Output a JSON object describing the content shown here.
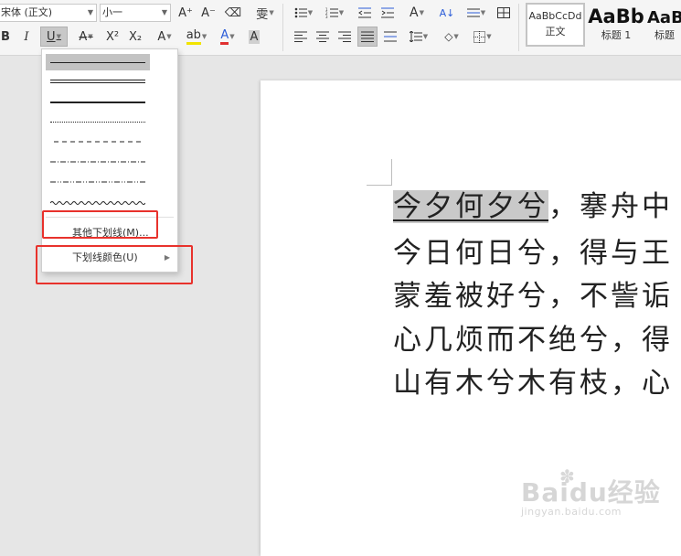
{
  "ribbon": {
    "font_name": "宋体 (正文)",
    "font_size": "小一",
    "btn_grow": "A⁺",
    "btn_shrink": "A⁻",
    "btn_clear": "⌫",
    "btn_phonetic": "雯",
    "btn_bold": "B",
    "btn_italic": "I",
    "btn_underline": "U",
    "btn_strike": "A",
    "btn_super": "X²",
    "btn_sub": "X₂",
    "btn_effects": "A",
    "btn_highlight": "ab",
    "btn_fontcolor": "A",
    "btn_charshade": "A",
    "btn_sort": "A↓",
    "styles": [
      {
        "sample": "AaBbCcDd",
        "name": "正文"
      },
      {
        "sample": "AaBb",
        "name": "标题 1"
      },
      {
        "sample": "AaB",
        "name": "标题"
      }
    ]
  },
  "underline_menu": {
    "line_styles": [
      "single",
      "double",
      "thick",
      "dotted",
      "dashed",
      "dash-dot",
      "dash-dot-dot",
      "wave"
    ],
    "more_underlines": "其他下划线(M)...",
    "underline_color": "下划线颜色(U)"
  },
  "document": {
    "lines": [
      {
        "selected": "今夕何夕兮",
        "rest": "，搴舟中"
      },
      {
        "text": "今日何日兮，得与王"
      },
      {
        "text": "蒙羞被好兮，不訾诟"
      },
      {
        "text": "心几烦而不绝兮，得"
      },
      {
        "text": "山有木兮木有枝，心"
      }
    ]
  },
  "watermark": {
    "main": "Baidu经验",
    "sub": "jingyan.baidu.com"
  },
  "colors": {
    "highlight_red": "#e8322c",
    "font_color_red": "#e03030",
    "font_color_blue": "#2b5cd8",
    "selection_gray": "#c9c9c9"
  }
}
